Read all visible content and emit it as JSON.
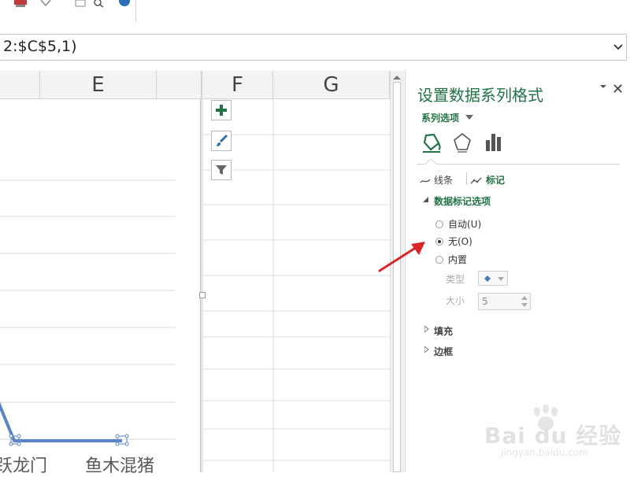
{
  "formula_bar": {
    "text": "2:$C$5,1)"
  },
  "columns": [
    {
      "label": "E"
    },
    {
      "label": "F"
    },
    {
      "label": "G"
    }
  ],
  "chart": {
    "labels": [
      "跃龙门",
      "鱼木混猪"
    ],
    "series_color": "#5b86c5"
  },
  "pane": {
    "title": "设置数据系列格式",
    "series_options_label": "系列选项",
    "close_glyph": "✕",
    "subtabs": [
      {
        "label": "线条"
      },
      {
        "label": "标记"
      }
    ],
    "section_marker": "数据标记选项",
    "radio_options": [
      {
        "label": "自动(U)",
        "selected": false
      },
      {
        "label": "无(O)",
        "selected": true
      },
      {
        "label": "内置",
        "selected": false
      }
    ],
    "type_label": "类型",
    "size_label": "大小",
    "size_value": "5",
    "section_fill": "填充",
    "section_border": "边框"
  },
  "watermark": {
    "text": "Bai du 经验",
    "url": "jingyan.baidu.com"
  },
  "colors": {
    "accent": "#217346",
    "arrow": "#d9252a"
  }
}
